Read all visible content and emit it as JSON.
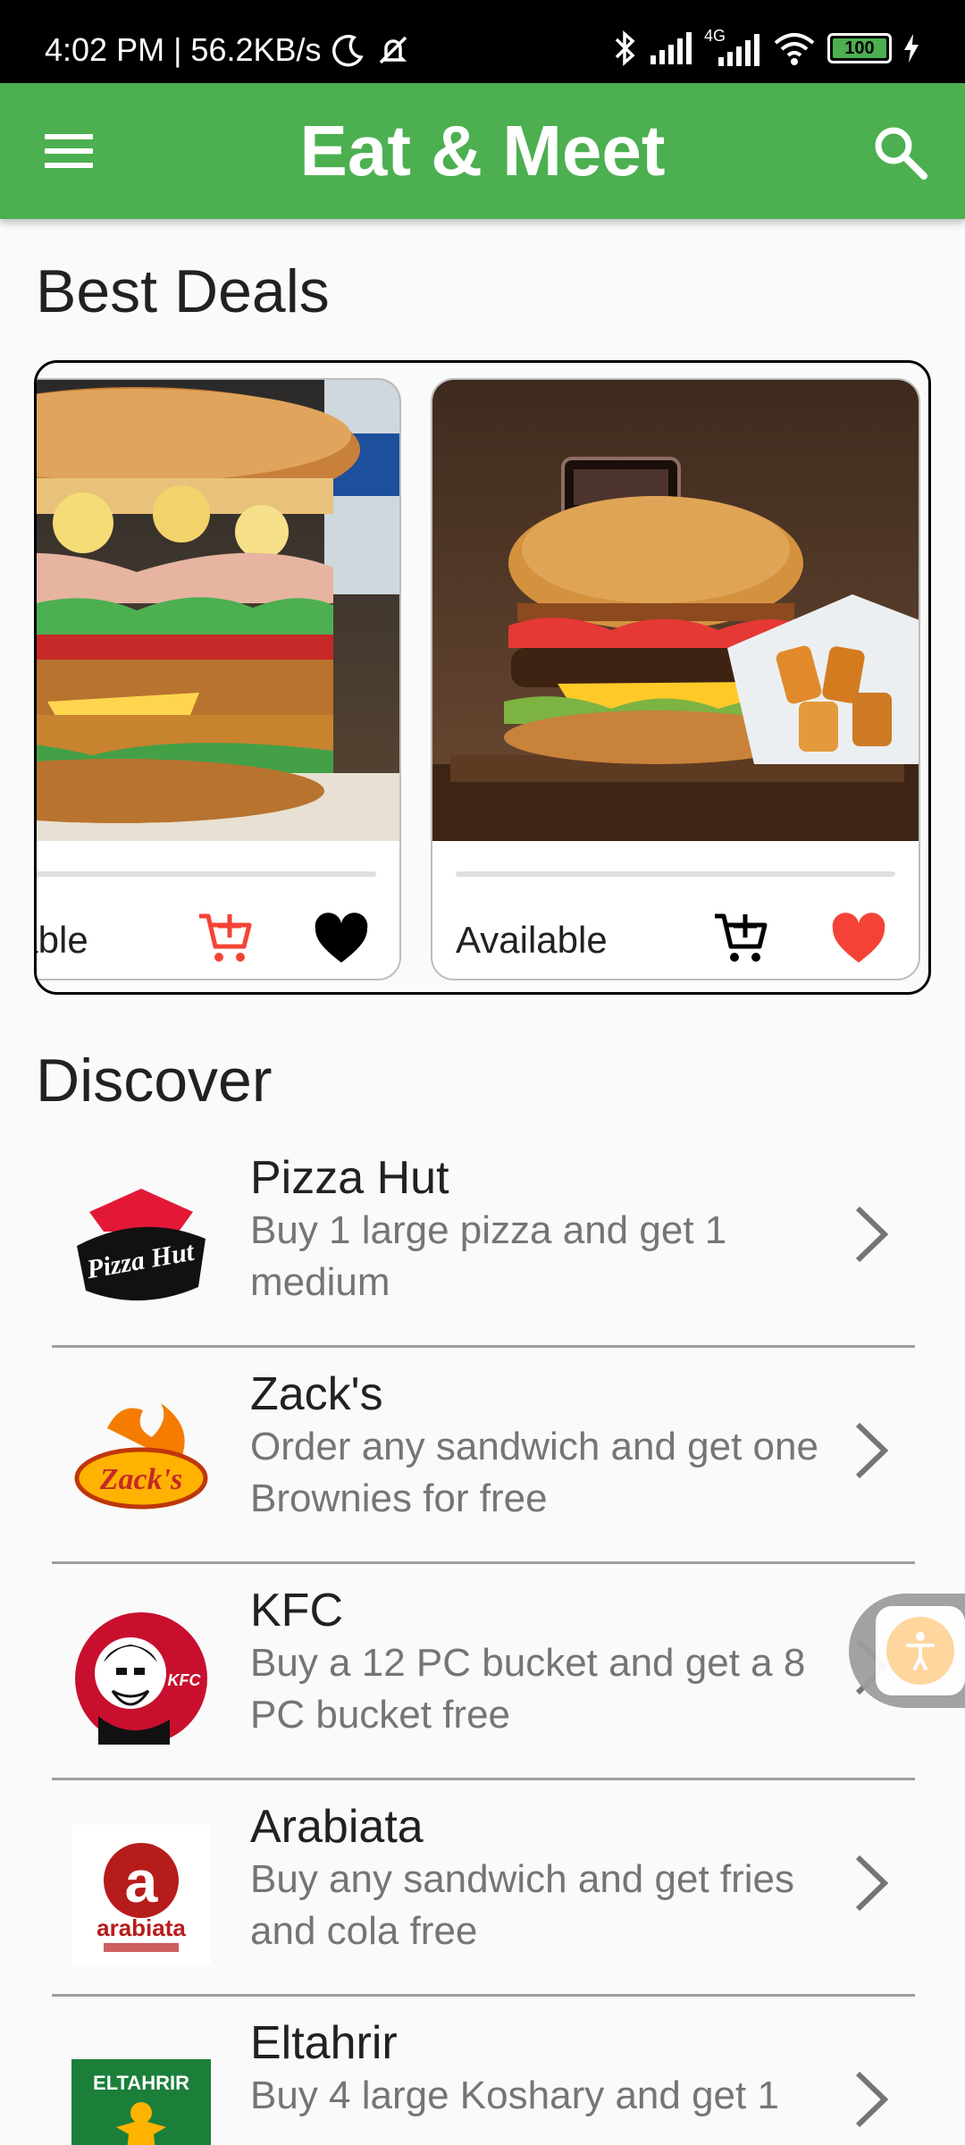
{
  "status_bar": {
    "time_speed": "4:02 PM | 56.2KB/s",
    "network": "4G",
    "battery": "100"
  },
  "app_bar": {
    "title": "Eat & Meet",
    "menu_icon": "menu-icon",
    "search_icon": "search-icon"
  },
  "best_deals": {
    "title": "Best Deals",
    "cards": [
      {
        "status": "Available",
        "image": "chicken-burger-image",
        "favorite": false
      },
      {
        "status": "Available",
        "image": "beef-burger-fries-image",
        "favorite": true
      }
    ]
  },
  "discover": {
    "title": "Discover",
    "items": [
      {
        "name": "Pizza Hut",
        "desc": "Buy 1 large pizza and get 1 medium",
        "logo": "pizza-hut-logo",
        "logo_text": "Pizza Hut"
      },
      {
        "name": "Zack's",
        "desc": "Order any sandwich and get one Brownies for free",
        "logo": "zacks-logo",
        "logo_text": "Zack's"
      },
      {
        "name": "KFC",
        "desc": "Buy a 12 PC bucket and get a 8 PC bucket free",
        "logo": "kfc-logo",
        "logo_text": "KFC"
      },
      {
        "name": "Arabiata",
        "desc": "Buy any sandwich and get fries and cola free",
        "logo": "arabiata-logo",
        "logo_text": "arabiata"
      },
      {
        "name": "Eltahrir",
        "desc": "Buy 4 large Koshary and get 1 ...",
        "logo": "eltahrir-logo",
        "logo_text": "ELTAHRIR"
      }
    ]
  },
  "colors": {
    "primary": "#4caf50",
    "accent_red": "#f44336",
    "text": "#212121",
    "secondary_text": "#757575"
  }
}
